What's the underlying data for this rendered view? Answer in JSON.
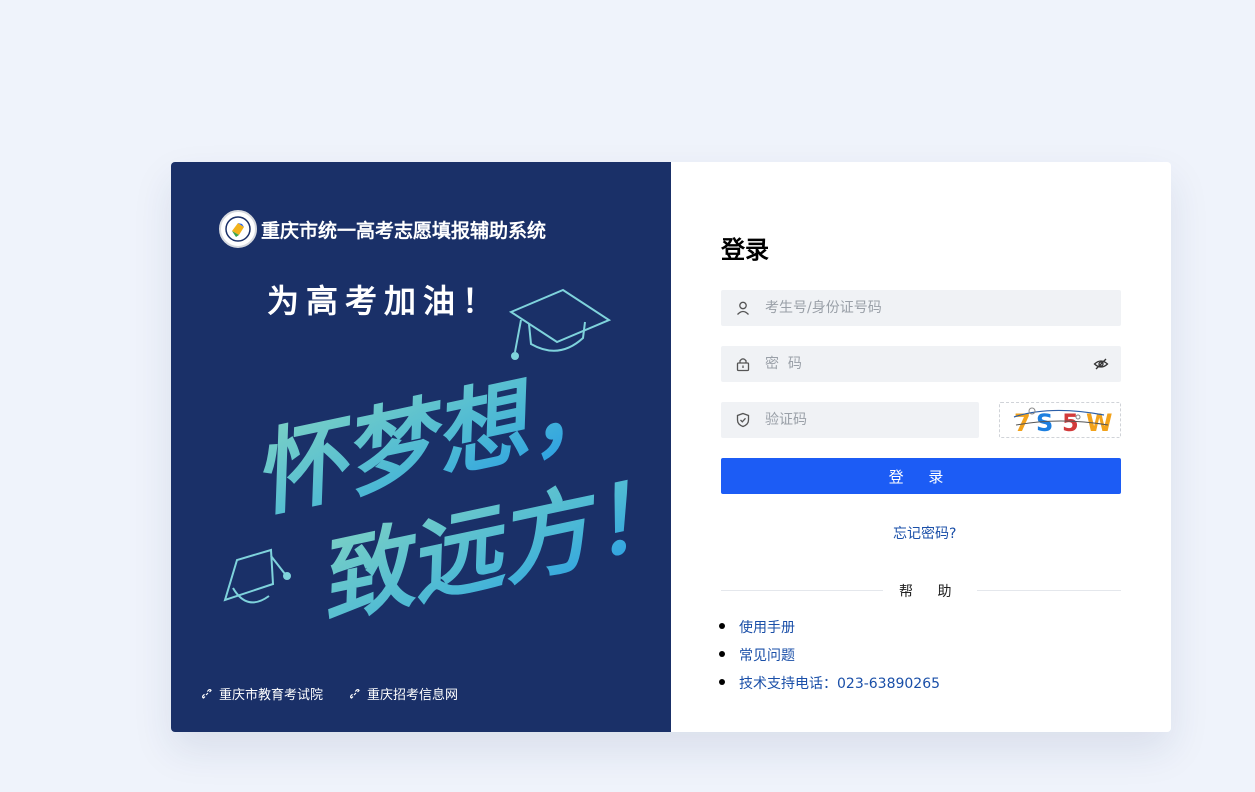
{
  "left_panel": {
    "system_title": "重庆市统一高考志愿填报辅助系统",
    "slogan": "为高考加油！",
    "art_line1": "怀梦想，",
    "art_line2": "致远方！",
    "links": [
      {
        "label": "重庆市教育考试院",
        "icon": "link-icon"
      },
      {
        "label": "重庆招考信息网",
        "icon": "link-icon"
      }
    ]
  },
  "login": {
    "title": "登录",
    "username_placeholder": "考生号/身份证号码",
    "password_placeholder": "密  码",
    "captcha_placeholder": "验证码",
    "captcha_text": "7S5W",
    "submit_label": "登 录",
    "forgot_label": "忘记密码?"
  },
  "help": {
    "title": "帮 助",
    "items": [
      "使用手册",
      "常见问题",
      "技术支持电话：023-63890265"
    ]
  },
  "colors": {
    "page_bg": "#eff3fb",
    "panel_bg": "#1a3068",
    "primary": "#1c5cf5",
    "link": "#1a4fa8"
  }
}
